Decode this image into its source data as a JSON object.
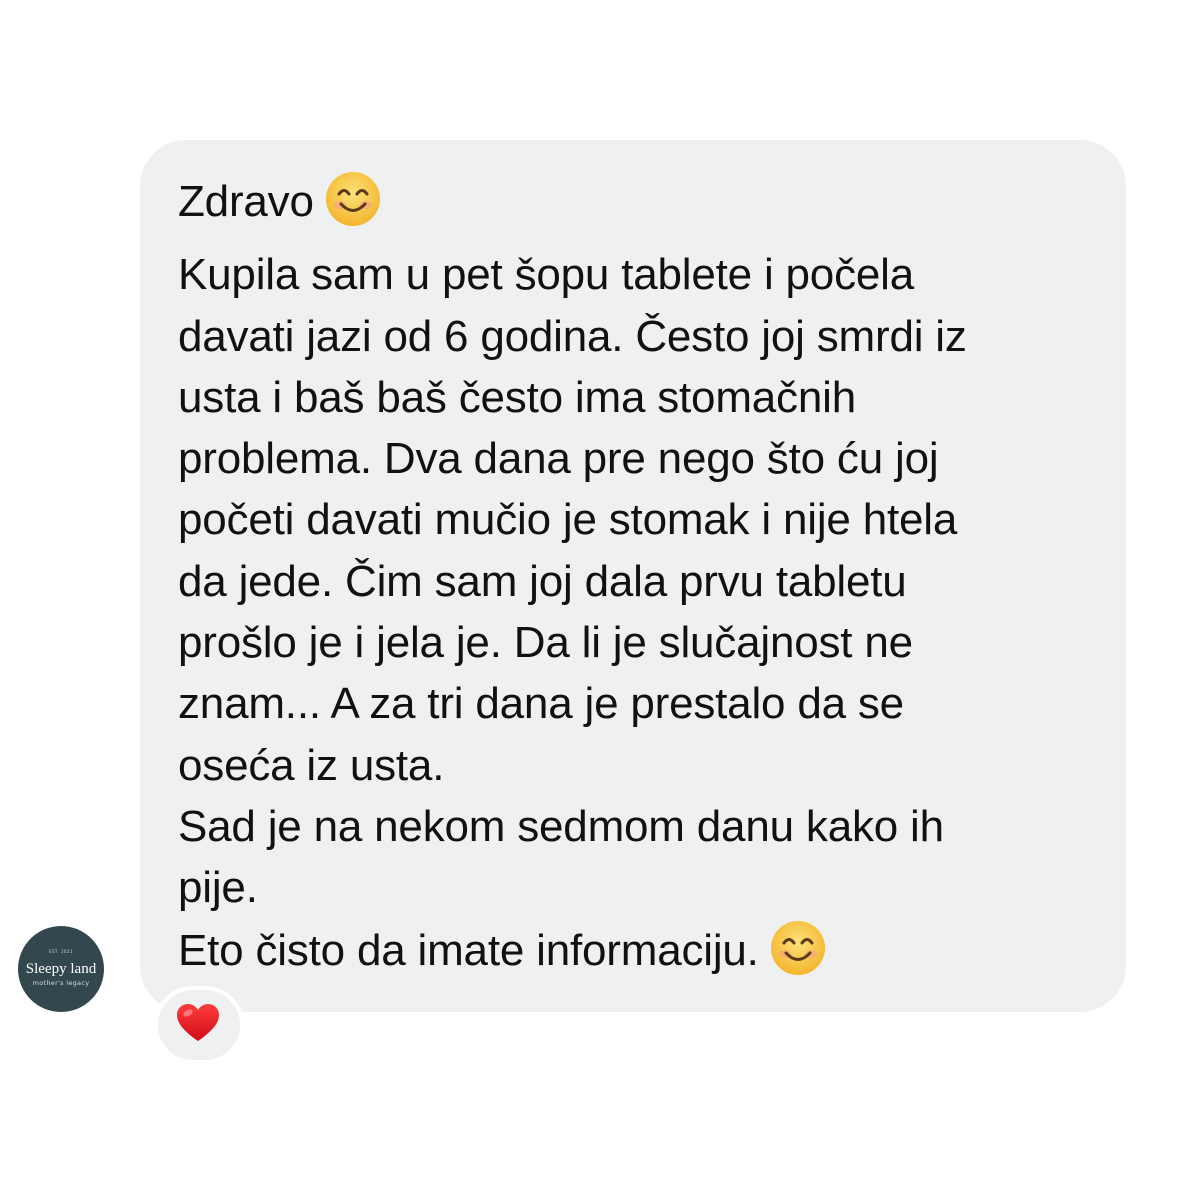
{
  "message": {
    "lines": [
      "Zdravo",
      "Kupila sam u pet šopu tablete i počela",
      "davati jazi od 6 godina. Često joj smrdi iz",
      "usta i baš baš često ima stomačnih",
      "problema. Dva dana pre nego što ću joj",
      "početi davati mučio je stomak i nije htela",
      "da jede. Čim sam joj dala prvu tabletu",
      "prošlo je i jela je. Da li je slučajnost ne",
      "znam... A za tri dana je prestalo da se",
      "oseća iz usta.",
      "Sad je na nekom sedmom danu kako ih",
      "pije.",
      "Eto čisto da imate informaciju."
    ],
    "emoji": [
      "smiling-face-icon",
      "smiling-face-icon"
    ]
  },
  "avatar": {
    "est": "EST. 2021",
    "brand": "Sleepy land",
    "tagline": "mother's legacy"
  },
  "reaction": {
    "icon": "red-heart-icon"
  },
  "colors": {
    "bubble": "#eff0f2",
    "text": "#111111",
    "avatar_bg": "#33474f",
    "heart": "#e0141e",
    "emoji_face": "#f7c44a"
  }
}
